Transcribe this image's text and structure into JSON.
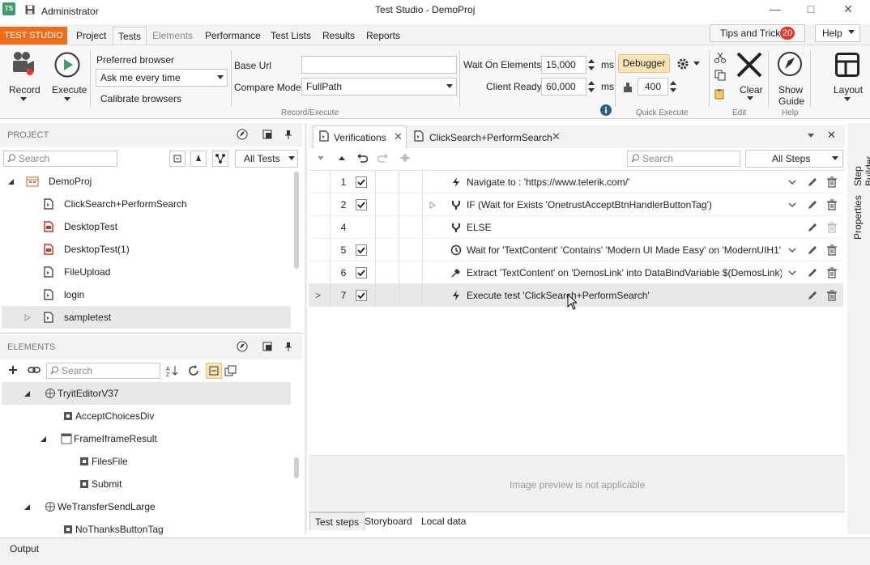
{
  "window": {
    "app_title": "Administrator",
    "project_title": "Test Studio - DemoProj",
    "logo": "TS"
  },
  "menu": {
    "app_tab": "TEST STUDIO",
    "tabs": [
      "Project",
      "Tests",
      "Elements",
      "Performance",
      "Test Lists",
      "Results",
      "Reports"
    ],
    "tips_label": "Tips and Tricks",
    "tips_count": "20",
    "help_label": "Help"
  },
  "ribbon": {
    "record": "Record",
    "execute": "Execute",
    "preferred_browser_label": "Preferred browser",
    "preferred_browser_value": "Ask me every time",
    "calibrate": "Calibrate browsers",
    "base_url_label": "Base Url",
    "base_url_value": "",
    "compare_mode_label": "Compare Mode",
    "compare_mode_value": "FullPath",
    "group_record_execute": "Record/Execute",
    "wait_on_elements_label": "Wait On Elements",
    "wait_on_elements_value": "15,000",
    "client_ready_label": "Client Ready",
    "client_ready_value": "60,000",
    "ms": "ms",
    "debugger": "Debugger",
    "delay_value": "400",
    "group_quick_execute": "Quick Execute",
    "clear": "Clear",
    "group_edit": "Edit",
    "show_guide": "Show Guide",
    "show": "Show",
    "guide": "Guide",
    "group_help": "Help",
    "layout": "Layout"
  },
  "project_panel": {
    "title": "PROJECT",
    "search_placeholder": "Search",
    "filter": "All Tests",
    "root": "DemoProj",
    "items": [
      "ClickSearch+PerformSearch",
      "DesktopTest",
      "DesktopTest(1)",
      "FileUpload",
      "login",
      "sampletest"
    ]
  },
  "elements_panel": {
    "title": "ELEMENTS",
    "search_placeholder": "Search",
    "items": [
      {
        "label": "TryitEditorV37"
      },
      {
        "label": "AcceptChoicesDiv"
      },
      {
        "label": "FrameIframeResult"
      },
      {
        "label": "FilesFile"
      },
      {
        "label": "Submit"
      },
      {
        "label": "WeTransferSendLarge"
      },
      {
        "label": "NoThanksButtonTag"
      }
    ]
  },
  "editor": {
    "tabs": [
      "Verifications",
      "ClickSearch+PerformSearch"
    ],
    "search_placeholder": "Search",
    "steps_filter": "All Steps",
    "steps": [
      {
        "num": "1",
        "text": "Navigate to : 'https://www.telerik.com/'"
      },
      {
        "num": "2",
        "text": "IF (Wait for Exists 'OnetrustAcceptBtnHandlerButtonTag')"
      },
      {
        "num": "4",
        "text": "ELSE"
      },
      {
        "num": "5",
        "text": "Wait for 'TextContent' 'Contains' 'Modern UI Made Easy' on 'ModernUIH1'"
      },
      {
        "num": "6",
        "text": "Extract 'TextContent' on 'DemosLink' into DataBindVariable $(DemosLink)"
      },
      {
        "num": "7",
        "text": "Execute test 'ClickSearch+PerformSearch'"
      }
    ],
    "preview_text": "Image preview is not applicable",
    "bottom_tabs": [
      "Test steps",
      "Storyboard",
      "Local data"
    ]
  },
  "side_tabs": [
    "Step Builder",
    "Properties"
  ],
  "output_label": "Output",
  "colors": {
    "accent": "#ef6c1a",
    "badge": "#e6352e",
    "debugger": "#fbe4b8",
    "logo": "#3d9e6b"
  }
}
